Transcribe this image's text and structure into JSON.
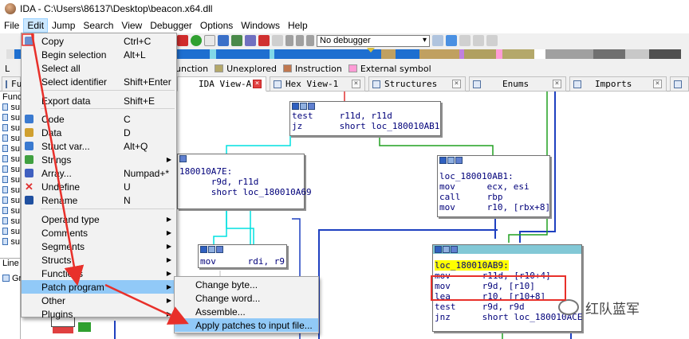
{
  "window": {
    "title": "IDA - C:\\Users\\86137\\Desktop\\beacon.x64.dll"
  },
  "menubar": [
    "File",
    "Edit",
    "Jump",
    "Search",
    "View",
    "Debugger",
    "Options",
    "Windows",
    "Help"
  ],
  "toolbar": {
    "debugger_select": "No debugger"
  },
  "legend": [
    {
      "label": "unction",
      "color": "#00ffff"
    },
    {
      "label": "Unexplored",
      "color": "#b4a86a"
    },
    {
      "label": "Instruction",
      "color": "#c07850"
    },
    {
      "label": "External symbol",
      "color": "#ff9cd6"
    }
  ],
  "legend_left_fragment": "L",
  "tabs": [
    "Fu",
    "IDA View-A",
    "Hex View-1",
    "Structures",
    "Enums",
    "Imports"
  ],
  "left_panel": {
    "header": "Func",
    "rows": [
      "su",
      "su",
      "su",
      "su",
      "su",
      "su",
      "su",
      "su",
      "su",
      "su",
      "su",
      "su",
      "su",
      "su"
    ],
    "line_label": "Line",
    "graph_label": "Gr"
  },
  "edit_menu": {
    "items": [
      {
        "label": "Copy",
        "shortcut": "Ctrl+C",
        "icon": "copy-icon"
      },
      {
        "label": "Begin selection",
        "shortcut": "Alt+L"
      },
      {
        "label": "Select all",
        "shortcut": ""
      },
      {
        "label": "Select identifier",
        "shortcut": "Shift+Enter"
      },
      {
        "label": "Export data",
        "shortcut": "Shift+E"
      },
      {
        "label": "Code",
        "shortcut": "C",
        "icon": "code-icon"
      },
      {
        "label": "Data",
        "shortcut": "D",
        "icon": "data-icon"
      },
      {
        "label": "Struct var...",
        "shortcut": "Alt+Q",
        "icon": "struct-icon"
      },
      {
        "label": "Strings",
        "shortcut": "",
        "submenu": true,
        "icon": "strings-icon"
      },
      {
        "label": "Array...",
        "shortcut": "Numpad+*",
        "icon": "array-icon"
      },
      {
        "label": "Undefine",
        "shortcut": "U",
        "icon": "undefine-icon"
      },
      {
        "label": "Rename",
        "shortcut": "N",
        "icon": "rename-icon"
      },
      {
        "label": "Operand type",
        "shortcut": "",
        "submenu": true
      },
      {
        "label": "Comments",
        "shortcut": "",
        "submenu": true
      },
      {
        "label": "Segments",
        "shortcut": "",
        "submenu": true
      },
      {
        "label": "Structs",
        "shortcut": "",
        "submenu": true
      },
      {
        "label": "Functions",
        "shortcut": "",
        "submenu": true
      },
      {
        "label": "Patch program",
        "shortcut": "",
        "submenu": true
      },
      {
        "label": "Other",
        "shortcut": "",
        "submenu": true
      },
      {
        "label": "Plugins",
        "shortcut": "",
        "submenu": true
      }
    ]
  },
  "patch_submenu": {
    "items": [
      "Change byte...",
      "Change word...",
      "Assemble...",
      "Apply patches to input file..."
    ]
  },
  "graph": {
    "node_top": [
      "test     r11d, r11d",
      "jz       short loc_180010AB1"
    ],
    "node_left_label": "180010A7E:",
    "node_left": [
      "      r9d, r11d",
      "      short loc_180010A69"
    ],
    "node_right": [
      "loc_180010AB1:",
      "mov      ecx, esi",
      "call     rbp",
      "mov      r10, [rbx+8]"
    ],
    "node_small": [
      "mov      rdi, r9"
    ],
    "node_main_label": "loc_180010AB9:",
    "node_main": [
      "mov      r11d, [r10+4]",
      "mov      r9d, [r10]",
      "lea      r10, [r10+8]",
      "test     r9d, r9d",
      "jnz      short loc_180010ACE"
    ]
  },
  "watermark": "红队蓝军",
  "annotation_color": "#e8302a"
}
